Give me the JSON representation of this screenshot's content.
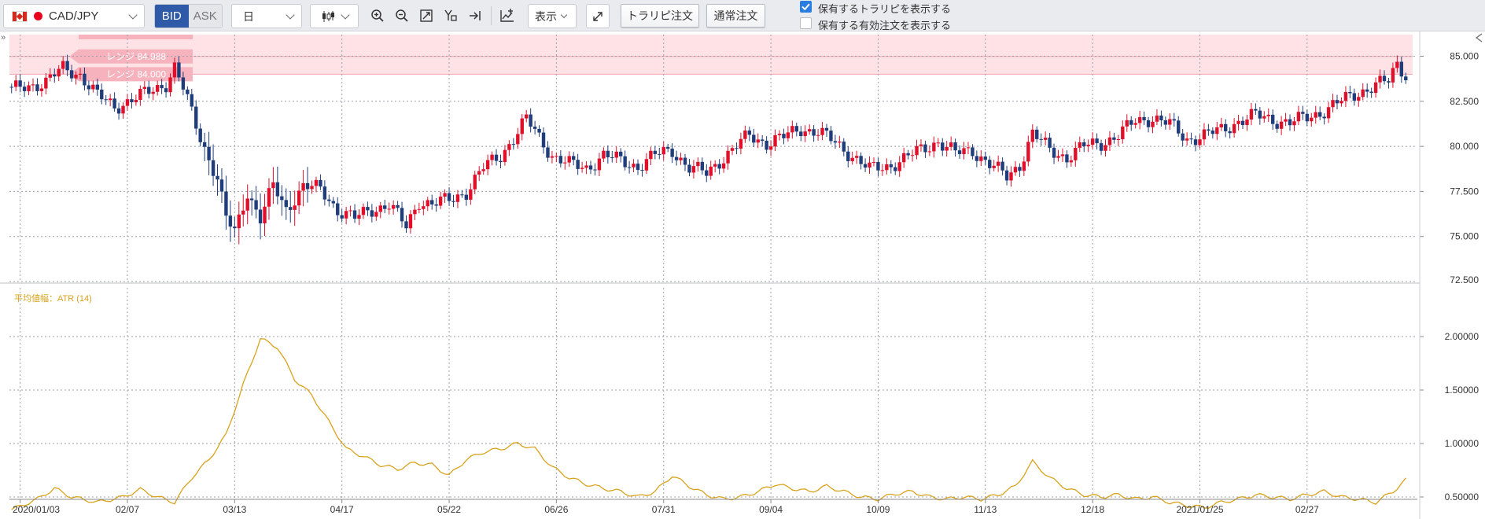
{
  "toolbar": {
    "pair": "CAD/JPY",
    "bid_label": "BID",
    "ask_label": "ASK",
    "period": "日",
    "display_label": "表示",
    "trap_order_label": "トラリピ注文",
    "normal_order_label": "通常注文",
    "show_held_trap_label": "保有するトラリピを表示する",
    "show_held_trap_checked": true,
    "show_held_orders_label": "保有する有効注文を表示する",
    "show_held_orders_checked": false
  },
  "range_band": {
    "label_upper": "レンジ 84.988",
    "label_lower": "レンジ 84.000",
    "upper": 86.2,
    "lower": 84.0,
    "mid_line": 84.988
  },
  "colors": {
    "up": "#e0102b",
    "down": "#1f3d7a",
    "atr_line": "#d9a21d",
    "band": "#ffe2e6",
    "band_label": "#f7b3bd"
  },
  "chart_data": [
    {
      "type": "candlestick",
      "title": "CAD/JPY",
      "ylim": [
        72.5,
        86.2
      ],
      "y_ticks": [
        "85.000",
        "82.500",
        "80.000",
        "77.500",
        "75.000",
        "72.500"
      ],
      "y_tick_values": [
        85,
        82.5,
        80,
        77.5,
        75,
        72.5
      ],
      "x_tick_labels": [
        "2020/01/03",
        "02/07",
        "03/13",
        "04/17",
        "05/22",
        "06/26",
        "07/31",
        "09/04",
        "10/09",
        "11/13",
        "12/18",
        "2021/01/25",
        "02/27"
      ],
      "grid": true,
      "candles_per_week": 5,
      "anchors": [
        [
          0,
          83.1
        ],
        [
          8,
          83.6
        ],
        [
          12,
          84.3
        ],
        [
          16,
          84.0
        ],
        [
          20,
          82.8
        ],
        [
          24,
          82.2
        ],
        [
          28,
          82.6
        ],
        [
          32,
          83.0
        ],
        [
          36,
          83.5
        ],
        [
          38,
          84.4
        ],
        [
          40,
          83.2
        ],
        [
          44,
          80.5
        ],
        [
          48,
          78.2
        ],
        [
          50,
          76.0
        ],
        [
          52,
          75.2
        ],
        [
          55,
          77.5
        ],
        [
          58,
          76.0
        ],
        [
          61,
          77.8
        ],
        [
          64,
          76.5
        ],
        [
          68,
          77.8
        ],
        [
          72,
          77.6
        ],
        [
          76,
          76.5
        ],
        [
          80,
          76.0
        ],
        [
          84,
          76.5
        ],
        [
          88,
          76.8
        ],
        [
          92,
          75.5
        ],
        [
          95,
          77.0
        ],
        [
          98,
          76.8
        ],
        [
          102,
          77.0
        ],
        [
          106,
          77.5
        ],
        [
          110,
          78.8
        ],
        [
          114,
          79.5
        ],
        [
          118,
          80.8
        ],
        [
          120,
          81.5
        ],
        [
          123,
          80.5
        ],
        [
          126,
          79.5
        ],
        [
          130,
          79.0
        ],
        [
          134,
          78.8
        ],
        [
          138,
          79.5
        ],
        [
          142,
          79.2
        ],
        [
          146,
          78.9
        ],
        [
          150,
          79.5
        ],
        [
          154,
          79.8
        ],
        [
          158,
          78.8
        ],
        [
          162,
          78.5
        ],
        [
          165,
          79.2
        ],
        [
          168,
          79.8
        ],
        [
          172,
          80.6
        ],
        [
          176,
          80.2
        ],
        [
          180,
          80.5
        ],
        [
          184,
          81.0
        ],
        [
          188,
          80.8
        ],
        [
          192,
          80.2
        ],
        [
          196,
          79.5
        ],
        [
          200,
          78.7
        ],
        [
          204,
          78.9
        ],
        [
          208,
          79.3
        ],
        [
          212,
          79.8
        ],
        [
          216,
          80.3
        ],
        [
          220,
          79.6
        ],
        [
          224,
          79.8
        ],
        [
          228,
          79.0
        ],
        [
          232,
          78.3
        ],
        [
          235,
          79.0
        ],
        [
          238,
          80.7
        ],
        [
          242,
          79.8
        ],
        [
          246,
          79.4
        ],
        [
          250,
          80.0
        ],
        [
          254,
          80.2
        ],
        [
          258,
          80.6
        ],
        [
          262,
          81.4
        ],
        [
          266,
          81.6
        ],
        [
          270,
          81.2
        ],
        [
          274,
          80.4
        ],
        [
          278,
          80.6
        ],
        [
          282,
          80.9
        ],
        [
          286,
          81.4
        ],
        [
          290,
          81.7
        ],
        [
          294,
          81.5
        ],
        [
          298,
          81.3
        ],
        [
          302,
          81.6
        ],
        [
          306,
          82.0
        ],
        [
          310,
          82.5
        ],
        [
          314,
          83.0
        ],
        [
          318,
          83.4
        ],
        [
          321,
          83.6
        ],
        [
          323,
          84.6
        ],
        [
          325,
          84.0
        ]
      ]
    },
    {
      "type": "line",
      "title": "平均値幅：ATR (14)",
      "ylim": [
        0.3,
        2.1
      ],
      "y_ticks": [
        "2.00000",
        "1.50000",
        "1.00000",
        "0.50000"
      ],
      "y_tick_values": [
        2.0,
        1.5,
        1.0,
        0.5
      ],
      "series": [
        {
          "name": "ATR (14)",
          "points": [
            [
              0,
              0.38
            ],
            [
              6,
              0.48
            ],
            [
              10,
              0.58
            ],
            [
              14,
              0.5
            ],
            [
              20,
              0.45
            ],
            [
              26,
              0.5
            ],
            [
              30,
              0.57
            ],
            [
              34,
              0.5
            ],
            [
              38,
              0.45
            ],
            [
              42,
              0.68
            ],
            [
              46,
              0.85
            ],
            [
              50,
              1.08
            ],
            [
              54,
              1.55
            ],
            [
              58,
              1.98
            ],
            [
              62,
              1.9
            ],
            [
              66,
              1.6
            ],
            [
              70,
              1.45
            ],
            [
              74,
              1.2
            ],
            [
              78,
              0.95
            ],
            [
              82,
              0.88
            ],
            [
              86,
              0.8
            ],
            [
              90,
              0.76
            ],
            [
              94,
              0.82
            ],
            [
              98,
              0.8
            ],
            [
              102,
              0.7
            ],
            [
              106,
              0.85
            ],
            [
              110,
              0.92
            ],
            [
              114,
              0.95
            ],
            [
              118,
              1.0
            ],
            [
              122,
              0.95
            ],
            [
              126,
              0.78
            ],
            [
              130,
              0.68
            ],
            [
              134,
              0.62
            ],
            [
              138,
              0.58
            ],
            [
              142,
              0.55
            ],
            [
              146,
              0.5
            ],
            [
              150,
              0.55
            ],
            [
              154,
              0.7
            ],
            [
              158,
              0.6
            ],
            [
              162,
              0.52
            ],
            [
              166,
              0.48
            ],
            [
              170,
              0.5
            ],
            [
              174,
              0.55
            ],
            [
              178,
              0.62
            ],
            [
              182,
              0.58
            ],
            [
              186,
              0.55
            ],
            [
              190,
              0.6
            ],
            [
              194,
              0.55
            ],
            [
              198,
              0.5
            ],
            [
              202,
              0.48
            ],
            [
              206,
              0.53
            ],
            [
              210,
              0.55
            ],
            [
              214,
              0.5
            ],
            [
              218,
              0.48
            ],
            [
              222,
              0.5
            ],
            [
              226,
              0.48
            ],
            [
              230,
              0.52
            ],
            [
              234,
              0.6
            ],
            [
              238,
              0.83
            ],
            [
              242,
              0.68
            ],
            [
              246,
              0.58
            ],
            [
              250,
              0.52
            ],
            [
              254,
              0.5
            ],
            [
              258,
              0.52
            ],
            [
              262,
              0.48
            ],
            [
              266,
              0.5
            ],
            [
              270,
              0.45
            ],
            [
              274,
              0.42
            ],
            [
              278,
              0.4
            ],
            [
              282,
              0.45
            ],
            [
              286,
              0.48
            ],
            [
              290,
              0.52
            ],
            [
              294,
              0.5
            ],
            [
              298,
              0.48
            ],
            [
              302,
              0.52
            ],
            [
              306,
              0.55
            ],
            [
              310,
              0.5
            ],
            [
              314,
              0.48
            ],
            [
              318,
              0.45
            ],
            [
              322,
              0.55
            ],
            [
              325,
              0.66
            ]
          ]
        }
      ]
    }
  ]
}
